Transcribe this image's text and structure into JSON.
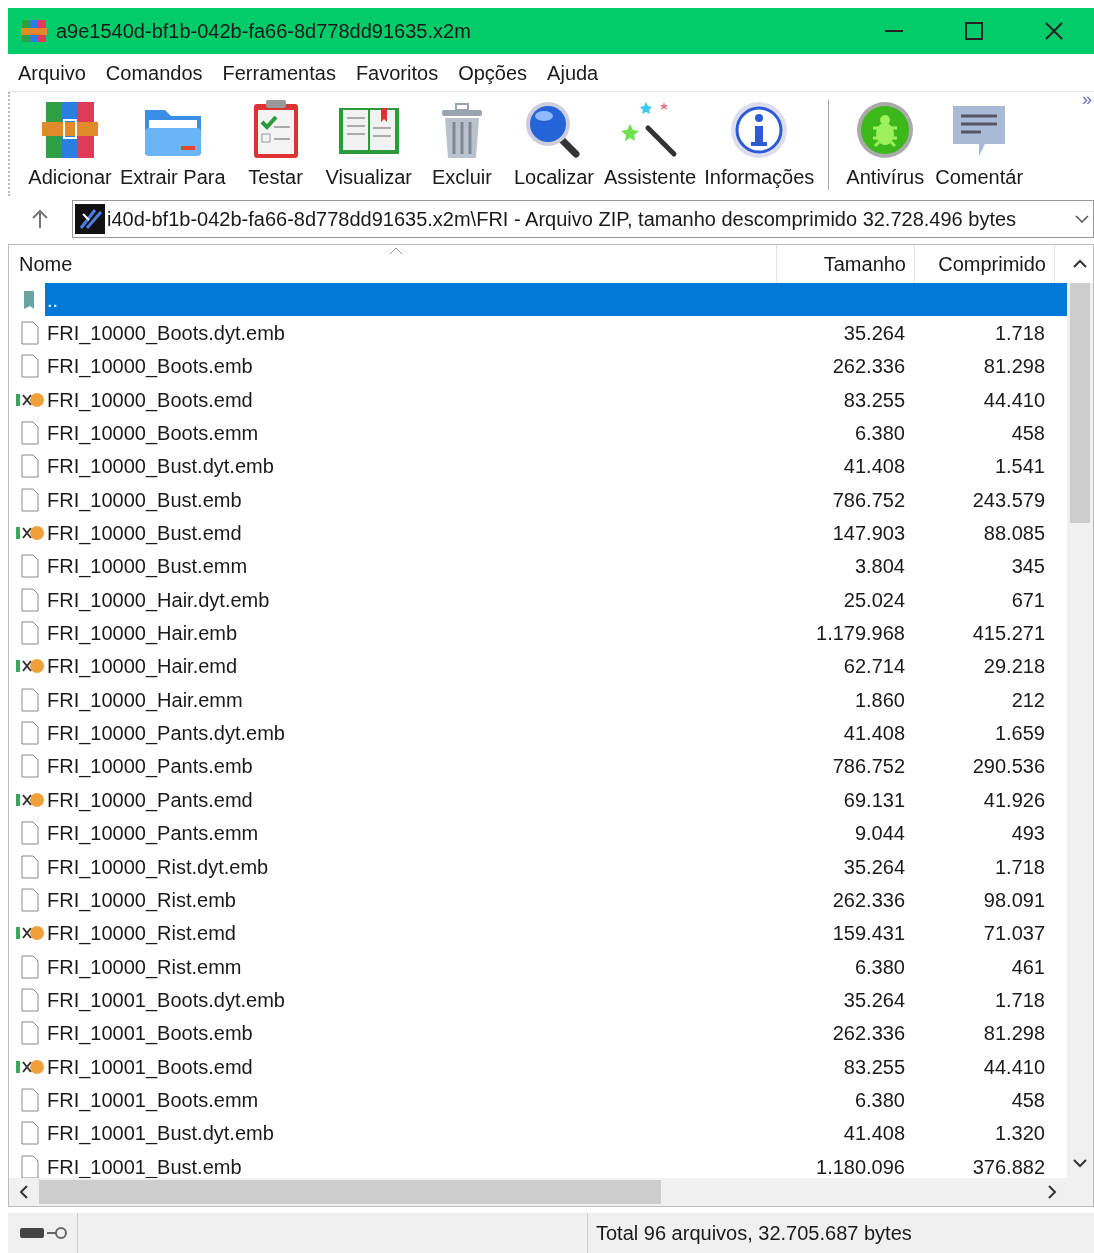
{
  "window": {
    "title": "a9e1540d-bf1b-042b-fa66-8d778dd91635.x2m"
  },
  "menu": [
    "Arquivo",
    "Comandos",
    "Ferramentas",
    "Favoritos",
    "Opções",
    "Ajuda"
  ],
  "toolbar": [
    {
      "label": "Adicionar",
      "kind": "add"
    },
    {
      "label": "Extrair Para",
      "kind": "extract"
    },
    {
      "label": "Testar",
      "kind": "test"
    },
    {
      "label": "Visualizar",
      "kind": "view"
    },
    {
      "label": "Excluir",
      "kind": "delete"
    },
    {
      "label": "Localizar",
      "kind": "find"
    },
    {
      "label": "Assistente",
      "kind": "wizard"
    },
    {
      "label": "Informações",
      "kind": "info"
    },
    {
      "label": "Antivírus",
      "kind": "antivirus"
    },
    {
      "label": "Comentár",
      "kind": "comment"
    }
  ],
  "more_button": "»",
  "address": {
    "value": "i40d-bf1b-042b-fa66-8d778dd91635.x2m\\FRI - Arquivo ZIP, tamanho descomprimido 32.728.496 bytes"
  },
  "table": {
    "columns": [
      "Nome",
      "Tamanho",
      "Comprimido"
    ],
    "rows": [
      {
        "name": "..",
        "size": "",
        "packed": "",
        "kind": "parent",
        "selected": true
      },
      {
        "name": "FRI_10000_Boots.dyt.emb",
        "size": "35.264",
        "packed": "1.718",
        "kind": "file",
        "selected": false
      },
      {
        "name": "FRI_10000_Boots.emb",
        "size": "262.336",
        "packed": "81.298",
        "kind": "file",
        "selected": false
      },
      {
        "name": "FRI_10000_Boots.emd",
        "size": "83.255",
        "packed": "44.410",
        "kind": "hxd",
        "selected": false
      },
      {
        "name": "FRI_10000_Boots.emm",
        "size": "6.380",
        "packed": "458",
        "kind": "file",
        "selected": false
      },
      {
        "name": "FRI_10000_Bust.dyt.emb",
        "size": "41.408",
        "packed": "1.541",
        "kind": "file",
        "selected": false
      },
      {
        "name": "FRI_10000_Bust.emb",
        "size": "786.752",
        "packed": "243.579",
        "kind": "file",
        "selected": false
      },
      {
        "name": "FRI_10000_Bust.emd",
        "size": "147.903",
        "packed": "88.085",
        "kind": "hxd",
        "selected": false
      },
      {
        "name": "FRI_10000_Bust.emm",
        "size": "3.804",
        "packed": "345",
        "kind": "file",
        "selected": false
      },
      {
        "name": "FRI_10000_Hair.dyt.emb",
        "size": "25.024",
        "packed": "671",
        "kind": "file",
        "selected": false
      },
      {
        "name": "FRI_10000_Hair.emb",
        "size": "1.179.968",
        "packed": "415.271",
        "kind": "file",
        "selected": false
      },
      {
        "name": "FRI_10000_Hair.emd",
        "size": "62.714",
        "packed": "29.218",
        "kind": "hxd",
        "selected": false
      },
      {
        "name": "FRI_10000_Hair.emm",
        "size": "1.860",
        "packed": "212",
        "kind": "file",
        "selected": false
      },
      {
        "name": "FRI_10000_Pants.dyt.emb",
        "size": "41.408",
        "packed": "1.659",
        "kind": "file",
        "selected": false
      },
      {
        "name": "FRI_10000_Pants.emb",
        "size": "786.752",
        "packed": "290.536",
        "kind": "file",
        "selected": false
      },
      {
        "name": "FRI_10000_Pants.emd",
        "size": "69.131",
        "packed": "41.926",
        "kind": "hxd",
        "selected": false
      },
      {
        "name": "FRI_10000_Pants.emm",
        "size": "9.044",
        "packed": "493",
        "kind": "file",
        "selected": false
      },
      {
        "name": "FRI_10000_Rist.dyt.emb",
        "size": "35.264",
        "packed": "1.718",
        "kind": "file",
        "selected": false
      },
      {
        "name": "FRI_10000_Rist.emb",
        "size": "262.336",
        "packed": "98.091",
        "kind": "file",
        "selected": false
      },
      {
        "name": "FRI_10000_Rist.emd",
        "size": "159.431",
        "packed": "71.037",
        "kind": "hxd",
        "selected": false
      },
      {
        "name": "FRI_10000_Rist.emm",
        "size": "6.380",
        "packed": "461",
        "kind": "file",
        "selected": false
      },
      {
        "name": "FRI_10001_Boots.dyt.emb",
        "size": "35.264",
        "packed": "1.718",
        "kind": "file",
        "selected": false
      },
      {
        "name": "FRI_10001_Boots.emb",
        "size": "262.336",
        "packed": "81.298",
        "kind": "file",
        "selected": false
      },
      {
        "name": "FRI_10001_Boots.emd",
        "size": "83.255",
        "packed": "44.410",
        "kind": "hxd",
        "selected": false
      },
      {
        "name": "FRI_10001_Boots.emm",
        "size": "6.380",
        "packed": "458",
        "kind": "file",
        "selected": false
      },
      {
        "name": "FRI_10001_Bust.dyt.emb",
        "size": "41.408",
        "packed": "1.320",
        "kind": "file",
        "selected": false
      },
      {
        "name": "FRI_10001_Bust.emb",
        "size": "1.180.096",
        "packed": "376.882",
        "kind": "file",
        "selected": false
      }
    ]
  },
  "status_bar": {
    "text": "Total 96 arquivos, 32.705.687 bytes"
  }
}
